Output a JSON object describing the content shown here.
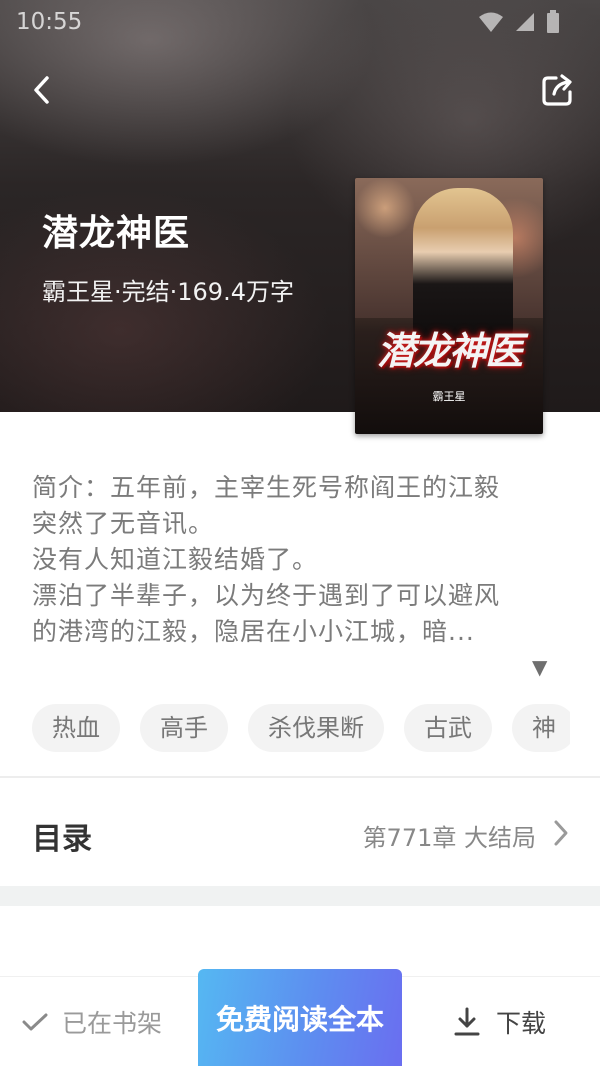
{
  "status_bar": {
    "time": "10:55"
  },
  "header": {
    "book_title": "潜龙神医",
    "book_meta": "霸王星·完结·169.4万字",
    "cover_title": "潜龙神医",
    "cover_author": "霸王星"
  },
  "intro": {
    "lines": [
      "简介：五年前，主宰生死号称阎王的江毅",
      "突然了无音讯。",
      "没有人知道江毅结婚了。",
      "漂泊了半辈子，以为终于遇到了可以避风",
      "的港湾的江毅，隐居在小小江城，暗..."
    ],
    "expand_glyph": "▼"
  },
  "tags": [
    "热血",
    "高手",
    "杀伐果断",
    "古武",
    "神"
  ],
  "toc": {
    "label": "目录",
    "latest_chapter": "第771章 大结局"
  },
  "bottom_bar": {
    "shelf_label": "已在书架",
    "read_label": "免费阅读全本",
    "download_label": "下载"
  },
  "colors": {
    "read_button_start": "#55b8f2",
    "read_button_end": "#6a6ef0",
    "tag_bg": "#f3f3f3"
  },
  "icons": [
    "back-arrow-icon",
    "share-icon",
    "wifi-icon",
    "signal-icon",
    "battery-icon",
    "chevron-right-icon",
    "checkmark-icon",
    "download-icon"
  ]
}
